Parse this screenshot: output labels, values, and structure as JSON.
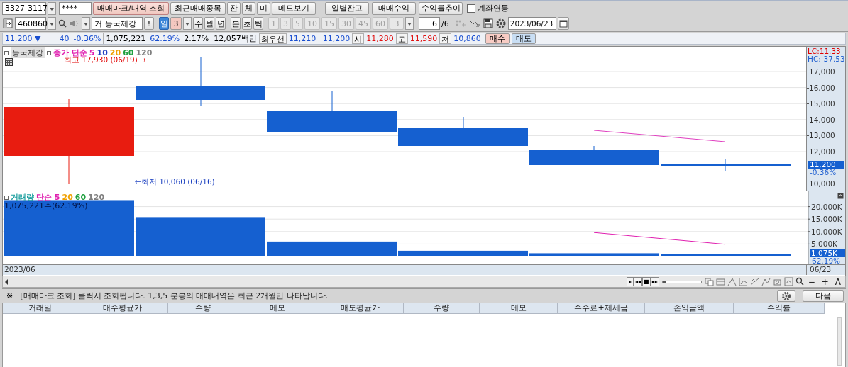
{
  "account_bar": {
    "account": "3327-3117",
    "password": "****",
    "buttons": [
      {
        "label": "매매마크/내역 조회",
        "selected": true
      },
      {
        "label": "최근매매종목",
        "selected": false
      },
      {
        "label": "잔",
        "selected": false
      },
      {
        "label": "체",
        "selected": false
      },
      {
        "label": "미",
        "selected": false
      },
      {
        "label": "메모보기",
        "selected": false
      }
    ],
    "report_buttons": [
      "일별잔고",
      "매매수익",
      "수익률추이"
    ],
    "link_checkbox": {
      "label": "계좌연동",
      "checked": false
    }
  },
  "symbol_bar": {
    "code": "460860",
    "market_tag": "거",
    "name": "동국제강",
    "alert_button": "!",
    "periods": [
      {
        "label": "일",
        "selected": true
      },
      {
        "label": "주",
        "selected": false
      },
      {
        "label": "월",
        "selected": false
      },
      {
        "label": "년",
        "selected": false
      },
      {
        "label": "분",
        "selected": false
      },
      {
        "label": "초",
        "selected": false
      },
      {
        "label": "틱",
        "selected": false
      }
    ],
    "period_count": "3",
    "minute_steps": [
      {
        "label": "1",
        "disabled": true
      },
      {
        "label": "3",
        "disabled": true
      },
      {
        "label": "5",
        "disabled": true
      },
      {
        "label": "10",
        "disabled": true
      },
      {
        "label": "15",
        "disabled": true
      },
      {
        "label": "30",
        "disabled": true
      },
      {
        "label": "45",
        "disabled": true
      },
      {
        "label": "60",
        "disabled": true
      }
    ],
    "minute_custom": "3",
    "view_count": "6",
    "view_total": "/6",
    "date": "2023/06/23"
  },
  "quote": {
    "fields": [
      {
        "text": "11,200 ▼",
        "kind": "down"
      },
      {
        "text": "40",
        "kind": "down"
      },
      {
        "text": "-0.36%",
        "kind": "down"
      },
      {
        "text": "1,075,221",
        "kind": "plain"
      },
      {
        "text": "62.19%",
        "kind": "down"
      },
      {
        "text": "2.17%",
        "kind": "plain"
      },
      {
        "text": "12,057백만",
        "kind": "plain"
      },
      {
        "text": "최우선",
        "kind": "label"
      },
      {
        "text": "11,210",
        "kind": "down"
      },
      {
        "text": "11,200",
        "kind": "down"
      },
      {
        "text": "시",
        "kind": "label"
      },
      {
        "text": "11,280",
        "kind": "up"
      },
      {
        "text": "고",
        "kind": "label"
      },
      {
        "text": "11,590",
        "kind": "up"
      },
      {
        "text": "저",
        "kind": "label"
      },
      {
        "text": "10,860",
        "kind": "down"
      }
    ],
    "buy_button": "매수",
    "sell_button": "매도"
  },
  "price_chart": {
    "symbol": "동국제강",
    "legend": [
      {
        "text": "종가 단순",
        "color": "#e020b0"
      },
      {
        "text": "5",
        "color": "#e020b0"
      },
      {
        "text": "10",
        "color": "#2040c0"
      },
      {
        "text": "20",
        "color": "#f0a000"
      },
      {
        "text": "60",
        "color": "#20a040"
      },
      {
        "text": "120",
        "color": "#808080"
      }
    ],
    "high_note": "최고 17,930 (06/19) →",
    "low_note": "←최저 10,060 (06/16)",
    "indicators": [
      {
        "text": "LC:11.33",
        "color": "#e00000"
      },
      {
        "text": "HC:-37.53",
        "color": "#2060d0"
      }
    ],
    "axis_ticks": [
      "17,000",
      "16,000",
      "15,000",
      "14,000",
      "13,000",
      "12,000"
    ],
    "axis_bottom_tick": "10,000",
    "last_price": "11,200",
    "last_change": "-0.36%"
  },
  "volume_chart": {
    "legend": [
      {
        "text": "20",
        "color": "#f0a000"
      },
      {
        "text": "60",
        "color": "#20a040"
      },
      {
        "text": "120",
        "color": "#808080"
      }
    ],
    "caption": "1,075,221주(62.19%)",
    "last_volume": "1,075K",
    "last_ratio": "62.19%",
    "chart_data": {
      "type": "bar",
      "series": [
        {
          "name": "거래량",
          "color": "#1560d0",
          "values": [
            22600,
            15800,
            6000,
            2300,
            1300,
            1100
          ]
        },
        {
          "name": "단순 5",
          "type": "line",
          "color": "#e020b0",
          "values": [
            null,
            null,
            null,
            null,
            9600,
            4900
          ]
        }
      ],
      "ylim": [
        0,
        25000
      ],
      "grid": true,
      "yticks": [
        {
          "value": 5000,
          "label": "5,000K"
        },
        {
          "value": 10000,
          "label": "10,000K"
        },
        {
          "value": 15000,
          "label": "15,000K"
        },
        {
          "value": 20000,
          "label": "20,000K"
        }
      ]
    }
  },
  "date_axis": {
    "start": "2023/06",
    "end": "06/23"
  },
  "chart_controls": {
    "nav_buttons": [
      "▸",
      "◂◂",
      "■",
      "▸▸"
    ],
    "zoom_slider": {
      "level": 0.1
    },
    "zoom_buttons": [
      "−",
      "+",
      "A"
    ]
  },
  "info_bar": {
    "mark": "※",
    "message": "[매매마크 조회] 클릭시 조회됩니다. 1,3,5 분봉의 매매내역은 최근 2개월만 나타납니다.",
    "next_button": "다음"
  },
  "table": {
    "columns": [
      "거래일",
      "매수평균가",
      "수량",
      "메모",
      "매도평균가",
      "수량",
      "메모",
      "수수료+제세금",
      "손익금액",
      "수익률"
    ]
  }
}
